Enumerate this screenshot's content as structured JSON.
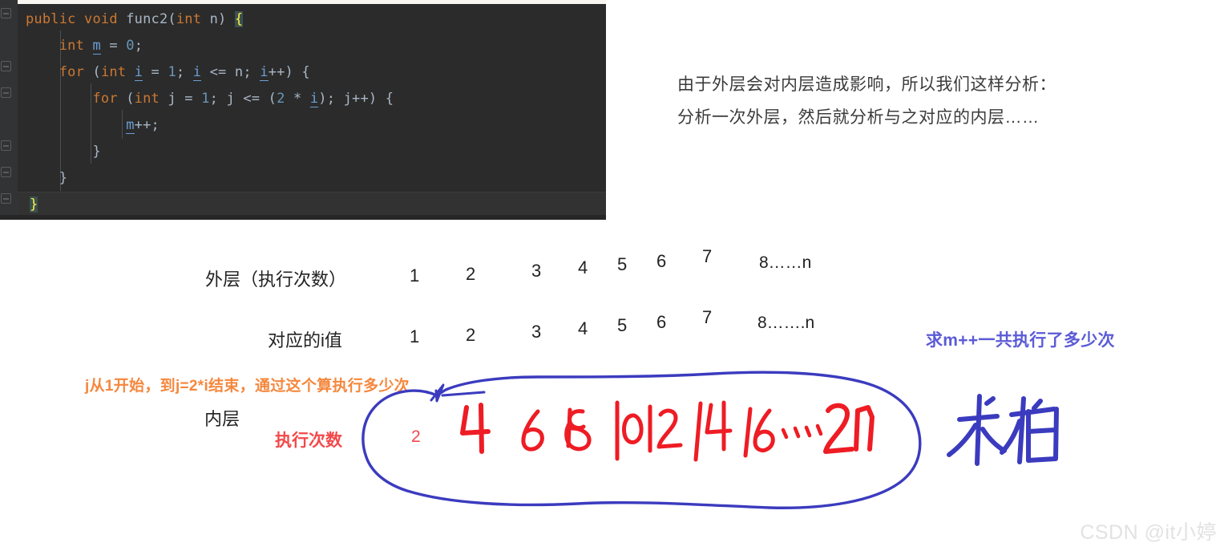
{
  "code": {
    "language": "java",
    "lines": [
      [
        {
          "t": "public",
          "c": "kw"
        },
        {
          "t": " ",
          "c": "plain"
        },
        {
          "t": "void",
          "c": "kw"
        },
        {
          "t": " ",
          "c": "plain"
        },
        {
          "t": "func2",
          "c": "meth"
        },
        {
          "t": "(",
          "c": "punct"
        },
        {
          "t": "int",
          "c": "kw"
        },
        {
          "t": " n",
          "c": "plain"
        },
        {
          "t": ") ",
          "c": "punct"
        },
        {
          "t": "{",
          "c": "brace-hl"
        }
      ],
      [
        {
          "t": "    ",
          "c": "plain"
        },
        {
          "t": "int",
          "c": "kw"
        },
        {
          "t": " ",
          "c": "plain"
        },
        {
          "t": "m",
          "c": "var"
        },
        {
          "t": " = ",
          "c": "plain"
        },
        {
          "t": "0",
          "c": "num"
        },
        {
          "t": ";",
          "c": "punct"
        }
      ],
      [
        {
          "t": "    ",
          "c": "plain"
        },
        {
          "t": "for",
          "c": "kw"
        },
        {
          "t": " (",
          "c": "punct"
        },
        {
          "t": "int",
          "c": "kw"
        },
        {
          "t": " ",
          "c": "plain"
        },
        {
          "t": "i",
          "c": "var"
        },
        {
          "t": " = ",
          "c": "plain"
        },
        {
          "t": "1",
          "c": "num"
        },
        {
          "t": "; ",
          "c": "punct"
        },
        {
          "t": "i",
          "c": "var"
        },
        {
          "t": " <= n; ",
          "c": "plain"
        },
        {
          "t": "i",
          "c": "var"
        },
        {
          "t": "++) {",
          "c": "plain"
        }
      ],
      [
        {
          "t": "        ",
          "c": "plain"
        },
        {
          "t": "for",
          "c": "kw"
        },
        {
          "t": " (",
          "c": "punct"
        },
        {
          "t": "int",
          "c": "kw"
        },
        {
          "t": " j = ",
          "c": "plain"
        },
        {
          "t": "1",
          "c": "num"
        },
        {
          "t": "; j <= (",
          "c": "plain"
        },
        {
          "t": "2",
          "c": "num"
        },
        {
          "t": " * ",
          "c": "plain"
        },
        {
          "t": "i",
          "c": "var"
        },
        {
          "t": "); j++) {",
          "c": "plain"
        }
      ],
      [
        {
          "t": "            ",
          "c": "plain"
        },
        {
          "t": "m",
          "c": "var"
        },
        {
          "t": "++;",
          "c": "plain"
        }
      ],
      [
        {
          "t": "        }",
          "c": "plain"
        }
      ],
      [
        {
          "t": "    }",
          "c": "plain"
        }
      ],
      [
        {
          "t": "",
          "c": "plain"
        }
      ],
      [
        {
          "t": "}",
          "c": "brace-hl"
        }
      ]
    ]
  },
  "note": {
    "line1": "由于外层会对内层造成影响，所以我们这样分析：",
    "line2": "分析一次外层，然后就分析与之对应的内层……"
  },
  "table": {
    "rows": [
      {
        "label": "外层（执行次数）",
        "values": [
          "1",
          "2",
          "3",
          "4",
          "5",
          "6",
          "7"
        ],
        "tail": "8……n"
      },
      {
        "label": "对应的i值",
        "values": [
          "1",
          "2",
          "3",
          "4",
          "5",
          "6",
          "7"
        ],
        "tail": "8…….n"
      }
    ]
  },
  "annotations": {
    "orange_note": "j从1开始，到j=2*i结束，通过这个算执行多少次",
    "blue_note": "求m++一共执行了多少次",
    "inner_label": "内层",
    "inner_count_label": "执行次数",
    "handwritten_first": "2",
    "handwritten_sequence": [
      "4",
      "6",
      "8",
      "10",
      "12",
      "14",
      "16",
      "…",
      "2n"
    ],
    "handwritten_sum": "求和"
  },
  "colors": {
    "editor_background": "#2b2b2b",
    "keyword": "#cc7832",
    "variable": "#6a9fd4",
    "number": "#6897bb",
    "plain_text": "#a9b7c6",
    "brace_highlight_text": "#ffef4a",
    "orange_annotation": "#f5883e",
    "red_annotation": "#f4494b",
    "blue_annotation": "#5b5bd6",
    "handwriting_red": "#ee1c24",
    "handwriting_blue": "#3b3bbf"
  },
  "watermark": {
    "text": "CSDN @it小婷"
  }
}
